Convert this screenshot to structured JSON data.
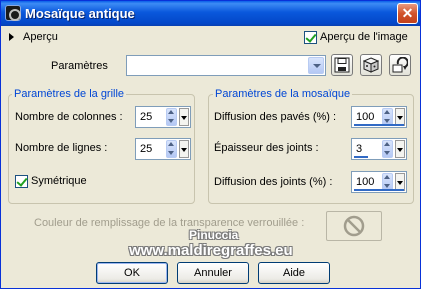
{
  "window": {
    "title": "Mosaïque antique",
    "close_glyph": "✕"
  },
  "preview": {
    "label": "Aperçu",
    "image_preview_label": "Aperçu de l'image",
    "image_preview_checked": true
  },
  "params": {
    "label": "Paramètres",
    "value": "",
    "tools": [
      "save-preset-icon",
      "random-dice-icon",
      "reset-preset-icon"
    ]
  },
  "grid": {
    "legend": "Paramètres de la grille",
    "columns_label": "Nombre de colonnes :",
    "columns_value": "25",
    "rows_label": "Nombre de lignes :",
    "rows_value": "25",
    "symmetric_label": "Symétrique",
    "symmetric_checked": true
  },
  "mosaic": {
    "legend": "Paramètres de la mosaïque",
    "tile_diffusion_label": "Diffusion des pavés (%) :",
    "tile_diffusion_value": "100",
    "joint_thickness_label": "Épaisseur des joints :",
    "joint_thickness_value": "3",
    "joint_diffusion_label": "Diffusion des joints (%) :",
    "joint_diffusion_value": "100"
  },
  "fill": {
    "label": "Couleur de remplissage de la transparence verrouillée :"
  },
  "watermark": {
    "line1": "Pinuccia",
    "line2": "www.maldiregraffes.eu"
  },
  "buttons": {
    "ok": "OK",
    "cancel": "Annuler",
    "help": "Aide"
  },
  "colors": {
    "titlebar": "#0a58dc",
    "dialog_bg": "#ece9d8",
    "legend": "#0046d5"
  }
}
